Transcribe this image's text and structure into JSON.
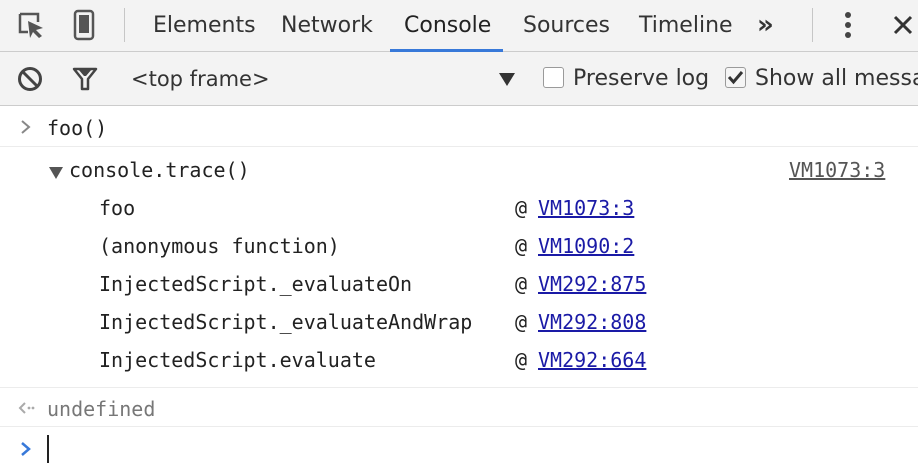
{
  "toolbar": {
    "icons": [
      "inspect-element-icon",
      "device-mode-icon"
    ],
    "tabs": [
      {
        "label": "Elements",
        "active": false
      },
      {
        "label": "Network",
        "active": false
      },
      {
        "label": "Console",
        "active": true
      },
      {
        "label": "Sources",
        "active": false
      },
      {
        "label": "Timeline",
        "active": false
      }
    ],
    "more_label": "»",
    "menu_icon": "vertical-dots-icon",
    "close_icon": "close-icon",
    "accent": "#3879d9"
  },
  "filterbar": {
    "clear_icon": "clear-console-icon",
    "filter_icon": "filter-icon",
    "frame_select": "<top frame>",
    "preserve_log": {
      "label": "Preserve log",
      "checked": false
    },
    "show_all": {
      "label": "Show all messag",
      "checked": true
    }
  },
  "console": {
    "input_command": "foo()",
    "trace": {
      "title": "console.trace()",
      "source": "VM1073:3",
      "frames": [
        {
          "fn": "foo",
          "at": "@",
          "loc": "VM1073:3"
        },
        {
          "fn": "(anonymous function)",
          "at": "@",
          "loc": "VM1090:2"
        },
        {
          "fn": "InjectedScript._evaluateOn",
          "at": "@",
          "loc": "VM292:875"
        },
        {
          "fn": "InjectedScript._evaluateAndWrap",
          "at": "@",
          "loc": "VM292:808"
        },
        {
          "fn": "InjectedScript.evaluate",
          "at": "@",
          "loc": "VM292:664"
        }
      ]
    },
    "result": "undefined",
    "prompt_value": ""
  }
}
